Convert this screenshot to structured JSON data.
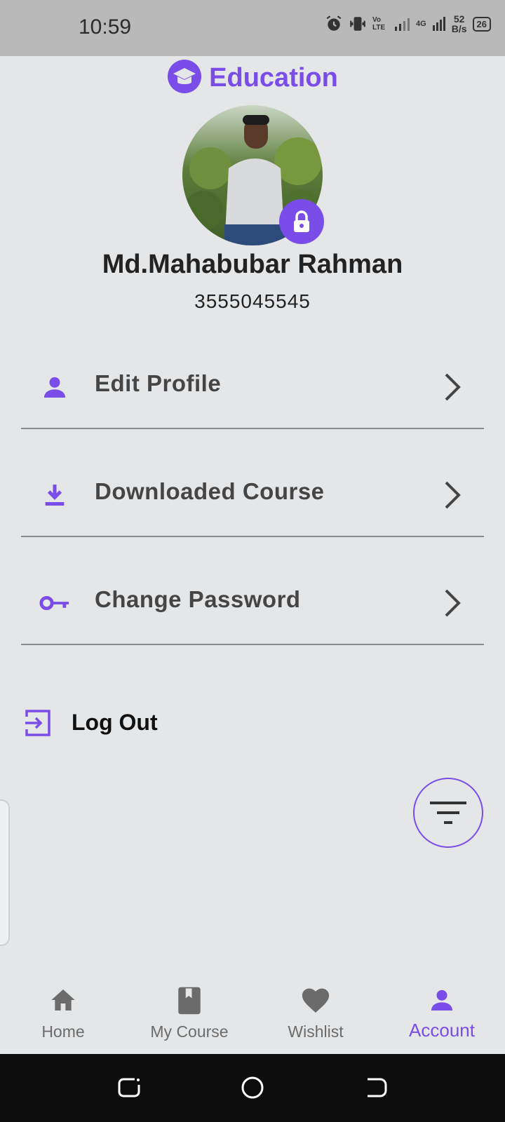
{
  "status_bar": {
    "time": "10:59",
    "net_speed_value": "52",
    "net_speed_unit": "B/s",
    "battery": "26",
    "volte": "Vo LTE",
    "net_type": "4G"
  },
  "brand": {
    "title": "Education",
    "accent": "#7a4ce8"
  },
  "profile": {
    "name": "Md.Mahabubar Rahman",
    "id": "3555045545"
  },
  "menu": [
    {
      "label": "Edit Profile",
      "icon": "person-icon"
    },
    {
      "label": "Downloaded Course",
      "icon": "download-icon"
    },
    {
      "label": "Change Password",
      "icon": "key-icon"
    }
  ],
  "logout": {
    "label": "Log Out",
    "icon": "logout-icon"
  },
  "bottom_nav": {
    "items": [
      {
        "label": "Home",
        "icon": "home-icon"
      },
      {
        "label": "My Course",
        "icon": "book-icon"
      },
      {
        "label": "Wishlist",
        "icon": "heart-icon"
      },
      {
        "label": "Account",
        "icon": "account-icon"
      }
    ],
    "active": "Account"
  }
}
